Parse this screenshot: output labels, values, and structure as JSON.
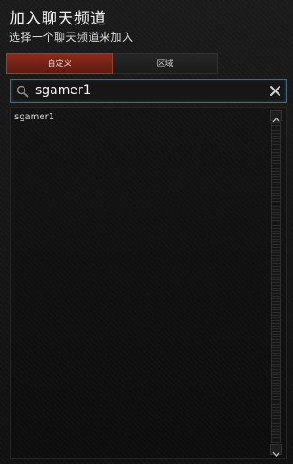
{
  "dialog": {
    "title": "加入聊天频道",
    "subtitle": "选择一个聊天频道来加入"
  },
  "tabs": [
    {
      "label": "自定义",
      "active": true
    },
    {
      "label": "区域",
      "active": false
    }
  ],
  "search": {
    "value": "sgamer1",
    "icon": "search-icon",
    "clear_icon": "close-icon"
  },
  "results": {
    "items": [
      "sgamer1"
    ]
  },
  "colors": {
    "accent_red": "#8a2a1c",
    "search_border": "#3d6a86",
    "background": "#121212"
  }
}
